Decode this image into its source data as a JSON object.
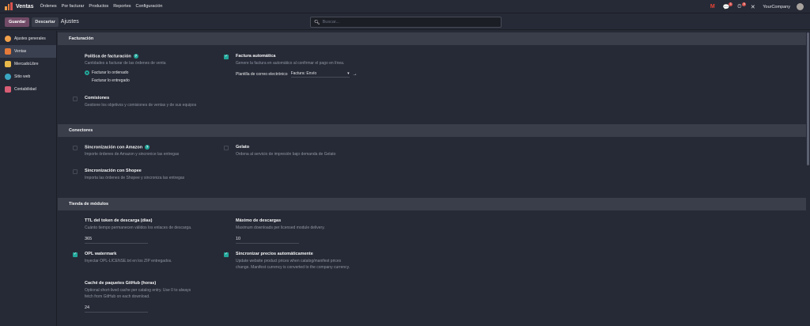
{
  "navbar": {
    "app_name": "Ventas",
    "menu": [
      "Órdenes",
      "Por facturar",
      "Productos",
      "Reportes",
      "Configuración"
    ],
    "company": "YourCompany",
    "messages_badge": "1",
    "activity_badge": "6"
  },
  "control": {
    "save_label": "Guardar",
    "discard_label": "Descartar",
    "breadcrumb": "Ajustes",
    "search_placeholder": "Buscar..."
  },
  "sidebar": {
    "items": [
      {
        "label": "Ajustes generales",
        "color": "#f0a04b"
      },
      {
        "label": "Ventas",
        "color": "#e57a3a"
      },
      {
        "label": "MercadoLibre",
        "color": "#e8b84a"
      },
      {
        "label": "Sitio web",
        "color": "#3aa6c2"
      },
      {
        "label": "Contabilidad",
        "color": "#d95d75"
      }
    ]
  },
  "sections": {
    "facturacion": {
      "title": "Facturación",
      "politica_title": "Política de facturación",
      "politica_desc": "Cantidades a facturar de las órdenes de venta",
      "radio_ordenado": "Facturar lo ordenado",
      "radio_entregado": "Facturar lo entregado",
      "factura_auto_title": "Factura automática",
      "factura_auto_desc": "Genere la factura en automático al confirmar el pago en línea.",
      "plantilla_label": "Plantilla de correo electrónico",
      "plantilla_value": "Factura: Envío",
      "comisiones_title": "Comisiones",
      "comisiones_desc": "Gestione los objetivos y comisiones de ventas y de sus equipos"
    },
    "conectores": {
      "title": "Conectores",
      "amazon_title": "Sincronización con Amazon",
      "amazon_desc": "Importe órdenes de Amazon y sincronice las entregas",
      "gelato_title": "Gelato",
      "gelato_desc": "Ordena al servicio de impresión bajo demanda de Gelato",
      "shopee_title": "Sincronización con Shopee",
      "shopee_desc": "Importa las órdenes de Shopee y sincroniza las entregas"
    },
    "tienda": {
      "title": "Tienda de módulos",
      "ttl_title": "TTL del token de descarga (días)",
      "ttl_desc": "Cuánto tiempo permanecen válidos los enlaces de descarga.",
      "ttl_value": "365",
      "max_title": "Máximo de descargas",
      "max_desc": "Maximum downloads per licensed module delivery.",
      "max_value": "10",
      "opl_title": "OPL watermark",
      "opl_desc": "Inyectar OPL-LICENSE.txt en los ZIP entregados.",
      "sync_title": "Sincronizar precios automáticamente",
      "sync_desc1": "Update website product prices when catalog/manifest prices",
      "sync_desc2": "change. Manifest currency is converted to the company currency.",
      "cache_title": "Caché de paquetes GitHub (horas)",
      "cache_desc1": "Optional short-lived cache per catalog entry. Use 0 to always",
      "cache_desc2": "fetch from GitHub on each download.",
      "cache_value": "24"
    }
  }
}
